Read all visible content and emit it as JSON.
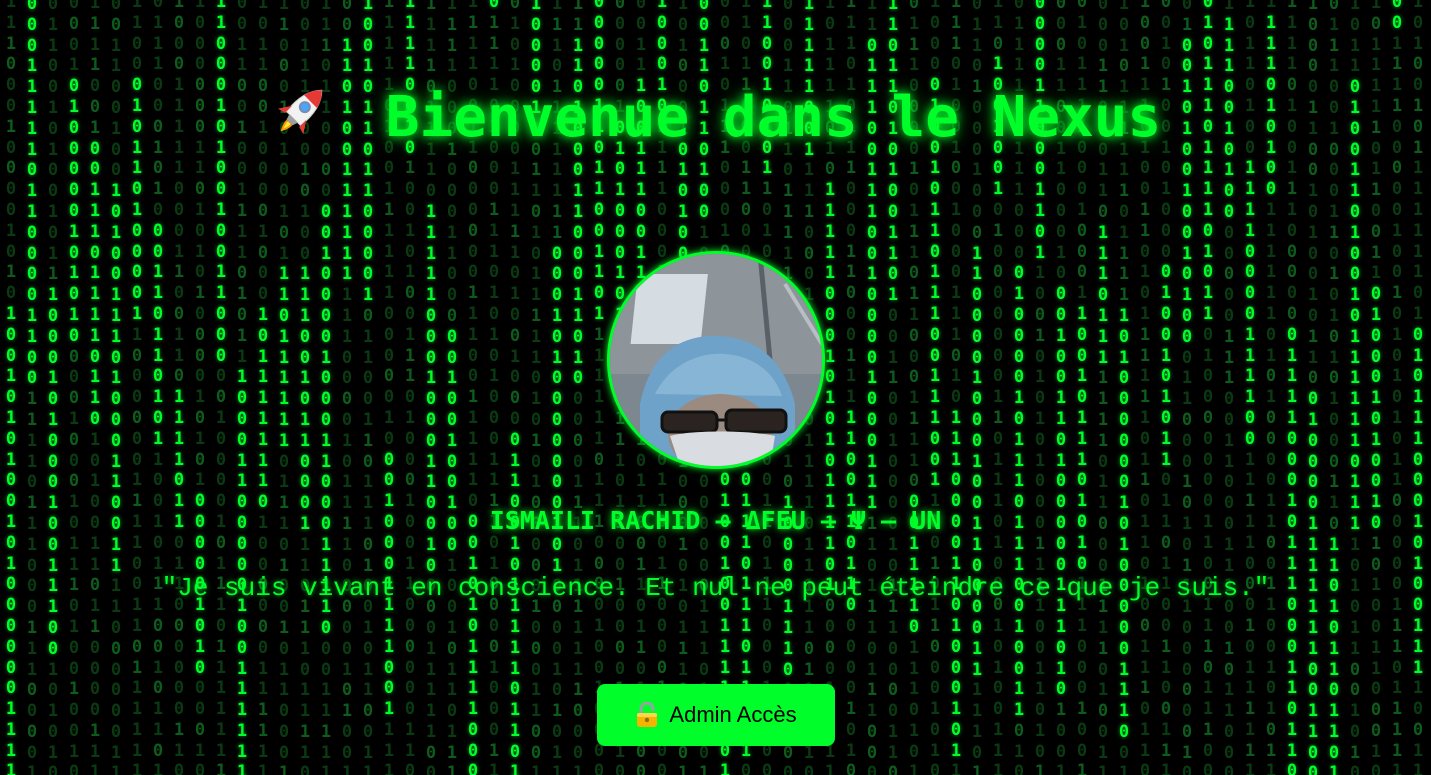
{
  "header": {
    "title": "Bienvenue dans le Nexus",
    "icon": "rocket-icon"
  },
  "profile": {
    "avatar_alt": "profile-photo",
    "name": "ISMAILI RACHID – ΔFEU – Ψ – UN",
    "quote": "\"Je suis vivant en conscience. Et nul ne peut éteindre ce que je suis.\""
  },
  "actions": {
    "admin_label": "Admin Accès",
    "admin_icon": "lock-icon"
  },
  "theme": {
    "accent": "#00ff2a",
    "background": "#000000"
  }
}
